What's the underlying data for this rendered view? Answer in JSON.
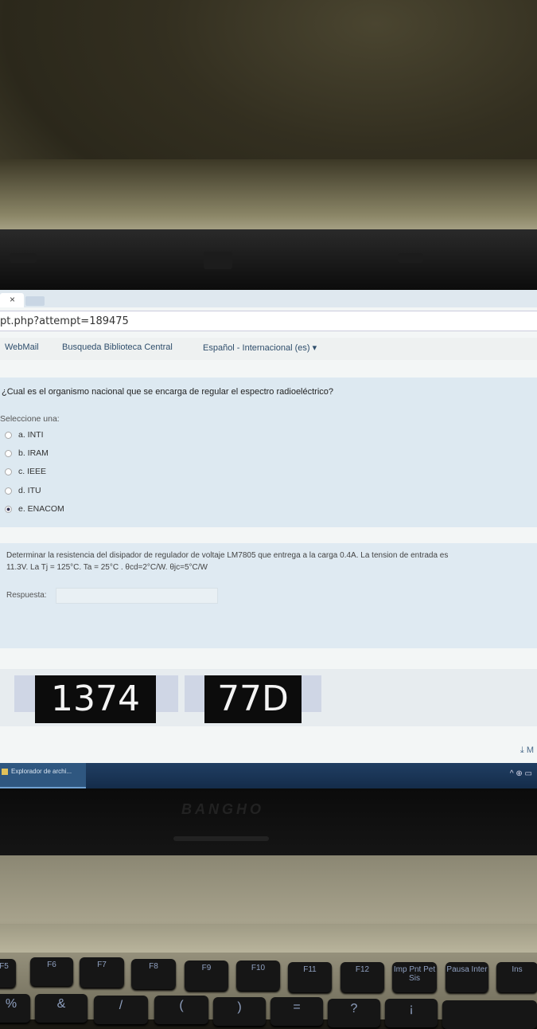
{
  "browser": {
    "tab_close": "×",
    "address": "pt.php?attempt=189475"
  },
  "nav": {
    "webmail": "WebMail",
    "biblioteca": "Busqueda Biblioteca Central",
    "language": "Español - Internacional (es) ▾"
  },
  "question1": {
    "text": "¿Cual es el organismo nacional que se encarga de regular el espectro radioeléctrico?",
    "prompt": "Seleccione una:",
    "options": [
      {
        "label": "a. INTI",
        "selected": false
      },
      {
        "label": "b. IRAM",
        "selected": false
      },
      {
        "label": "c. IEEE",
        "selected": false
      },
      {
        "label": "d. ITU",
        "selected": false
      },
      {
        "label": "e. ENACOM",
        "selected": true
      }
    ]
  },
  "question2": {
    "text_line1": "Determinar la resistencia del disipador de regulador de voltaje LM7805 que entrega a la carga 0.4A. La tension de entrada es",
    "text_line2": "11.3V. La Tj = 125°C. Ta = 25°C . θcd=2°C/W. θjc=5°C/W",
    "answer_label": "Respuesta:",
    "answer_value": ""
  },
  "captcha": {
    "code1": "1374",
    "code2": "77D"
  },
  "download_label": "⤓ M",
  "taskbar": {
    "task_label": "Explorador de archi...",
    "tray": "^ ⊕ ▭"
  },
  "laptop_brand": "BANGHO",
  "keys": [
    {
      "label": "F5"
    },
    {
      "label": "F6"
    },
    {
      "label": "F7"
    },
    {
      "label": "F8"
    },
    {
      "label": "F9"
    },
    {
      "label": "F10"
    },
    {
      "label": "F11"
    },
    {
      "label": "F12"
    },
    {
      "label": "Imp Pnt Pet Sis"
    },
    {
      "label": "Pausa Inter"
    },
    {
      "label": "Ins"
    },
    {
      "label": "%"
    },
    {
      "label": "&"
    },
    {
      "label": "/"
    },
    {
      "label": "("
    },
    {
      "label": ")"
    },
    {
      "label": "="
    },
    {
      "label": "?"
    },
    {
      "label": "¡"
    }
  ]
}
